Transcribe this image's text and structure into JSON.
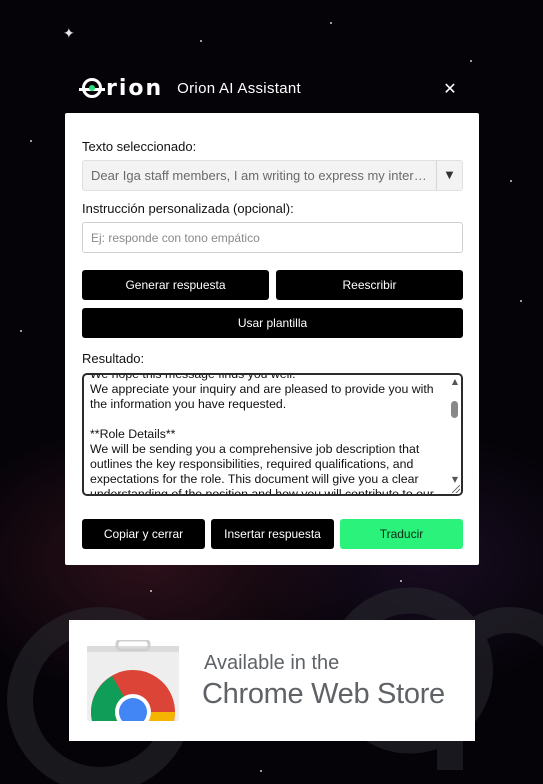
{
  "header": {
    "logo_text": "rion",
    "title": "Orion AI Assistant",
    "close_symbol": "✕"
  },
  "form": {
    "selected_text_label": "Texto seleccionado:",
    "selected_text_value": "Dear Iga staff members, I am writing to express my interest in the position",
    "custom_instruction_label": "Instrucción personalizada (opcional):",
    "custom_instruction_placeholder": "Ej: responde con tono empático",
    "result_label": "Resultado:"
  },
  "buttons": {
    "generate": "Generar respuesta",
    "rewrite": "Reescribir",
    "use_template": "Usar plantilla",
    "copy_close": "Copiar y cerrar",
    "insert": "Insertar respuesta",
    "translate": "Traducir"
  },
  "result_text": "We hope this message finds you well.\nWe appreciate your inquiry and are pleased to provide you with the information you have requested.\n\n**Role Details**\nWe will be sending you a comprehensive job description that outlines the key responsibilities, required qualifications, and expectations for the role. This document will give you a clear understanding of the position and how you will contribute to our team.",
  "badge": {
    "line1": "Available in the",
    "line2": "Chrome Web Store"
  },
  "colors": {
    "accent_green": "#2af27b",
    "button_black": "#000000",
    "background": "#050308"
  }
}
